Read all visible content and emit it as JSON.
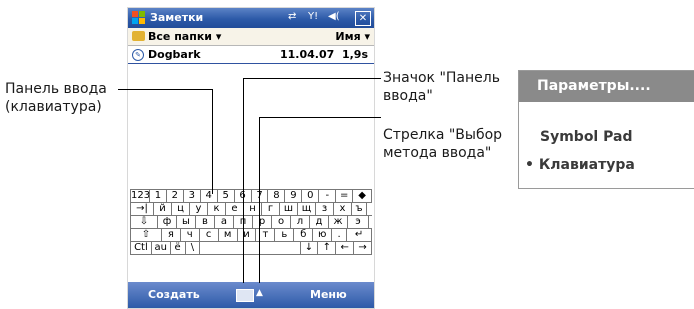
{
  "callouts": {
    "input_panel": [
      "Панель ввода",
      "(клавиатура)"
    ],
    "input_panel_icon": [
      "Значок \"Панель",
      "ввода\""
    ],
    "input_method_arrow": [
      "Стрелка \"Выбор",
      "метода ввода\""
    ]
  },
  "titlebar": {
    "title": "Заметки",
    "icons": [
      "sync-icon",
      "signal-icon",
      "volume-icon"
    ],
    "close": "✕"
  },
  "folder_bar": {
    "folder": "Все папки ▾",
    "sort": "Имя ▾"
  },
  "notes": [
    {
      "name": "Dogbark",
      "date": "11.04.07",
      "size": "1,9s"
    }
  ],
  "keyboard": {
    "rows": [
      [
        "123",
        "1",
        "2",
        "3",
        "4",
        "5",
        "6",
        "7",
        "8",
        "9",
        "0",
        "-",
        "=",
        "◆"
      ],
      [
        "→|",
        "й",
        "ц",
        "у",
        "к",
        "е",
        "н",
        "г",
        "ш",
        "щ",
        "з",
        "х",
        "ъ"
      ],
      [
        "⇩",
        "ф",
        "ы",
        "в",
        "а",
        "п",
        "р",
        "о",
        "л",
        "д",
        "ж",
        "э"
      ],
      [
        "⇧",
        "я",
        "ч",
        "с",
        "м",
        "и",
        "т",
        "ь",
        "б",
        "ю",
        ".",
        "↵"
      ],
      [
        "Ctl",
        "au",
        "ё",
        "\\",
        "",
        "↓",
        "↑",
        "←",
        "→"
      ]
    ]
  },
  "softkeys": {
    "left": "Создать",
    "right": "Меню",
    "sip_arrow": "▲"
  },
  "menu": {
    "header": "Параметры....",
    "items": [
      "Symbol Pad",
      "Клавиатура"
    ],
    "selected": "• "
  }
}
